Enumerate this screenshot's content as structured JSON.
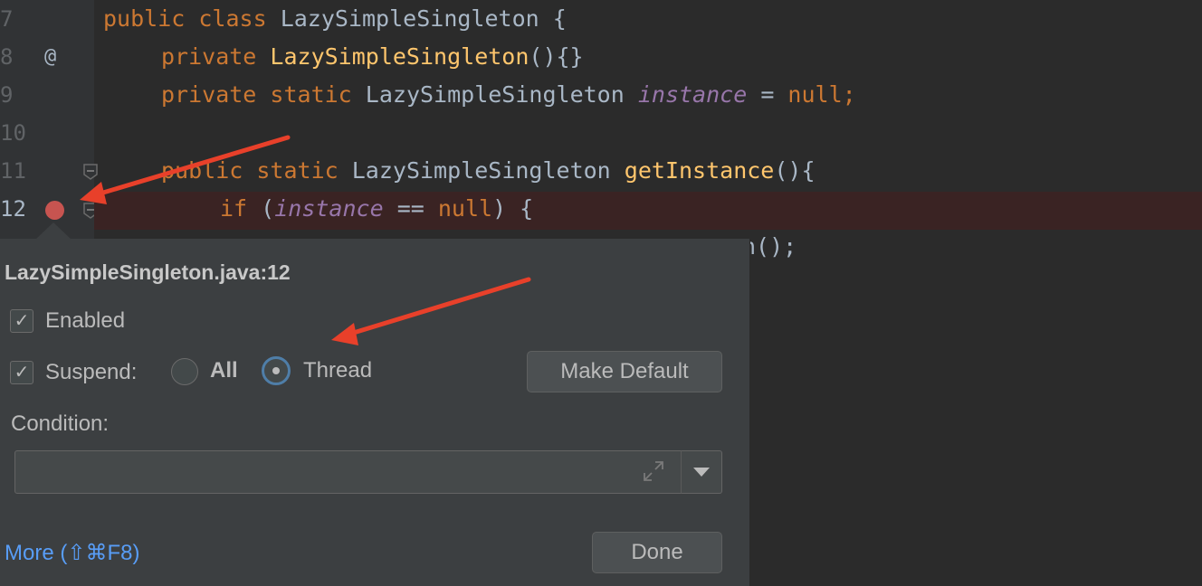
{
  "gutter": {
    "line_numbers": [
      "7",
      "8",
      "9",
      "10",
      "11",
      "12"
    ],
    "override_marker": "@"
  },
  "code": {
    "line7": {
      "kw1": "public",
      "kw2": "class",
      "name": "LazySimpleSingleton",
      "rest": " {"
    },
    "line8": {
      "kw": "private",
      "fn": "LazySimpleSingleton",
      "rest": "(){}"
    },
    "line9": {
      "kw1": "private",
      "kw2": "static",
      "type": "LazySimpleSingleton",
      "field": "instance",
      "eq": " = ",
      "val": "null",
      "semi": ";"
    },
    "line11": {
      "kw1": "public",
      "kw2": "static",
      "type": "LazySimpleSingleton",
      "fn": "getInstance",
      "rest": "(){"
    },
    "line12": {
      "kw": "if",
      "open": " (",
      "field": "instance",
      "op": " == ",
      "val": "null",
      "close": ") {"
    },
    "line13": {
      "partial": "n();"
    }
  },
  "popup": {
    "title": "LazySimpleSingleton.java:12",
    "enabled_label": "Enabled",
    "suspend_label": "Suspend:",
    "all_label": "All",
    "thread_label": "Thread",
    "make_default_label": "Make Default",
    "condition_label": "Condition:",
    "condition_value": "",
    "more_link": "More (⇧⌘F8)",
    "done_label": "Done",
    "enabled_checked": true,
    "suspend_checked": true,
    "suspend_mode": "Thread"
  },
  "colors": {
    "editor_bg": "#2b2b2b",
    "keyword": "#cc7832",
    "function": "#ffc66d",
    "field": "#9876aa",
    "breakpoint": "#c75450",
    "annotation_arrow": "#e8402a",
    "link": "#589df6"
  }
}
